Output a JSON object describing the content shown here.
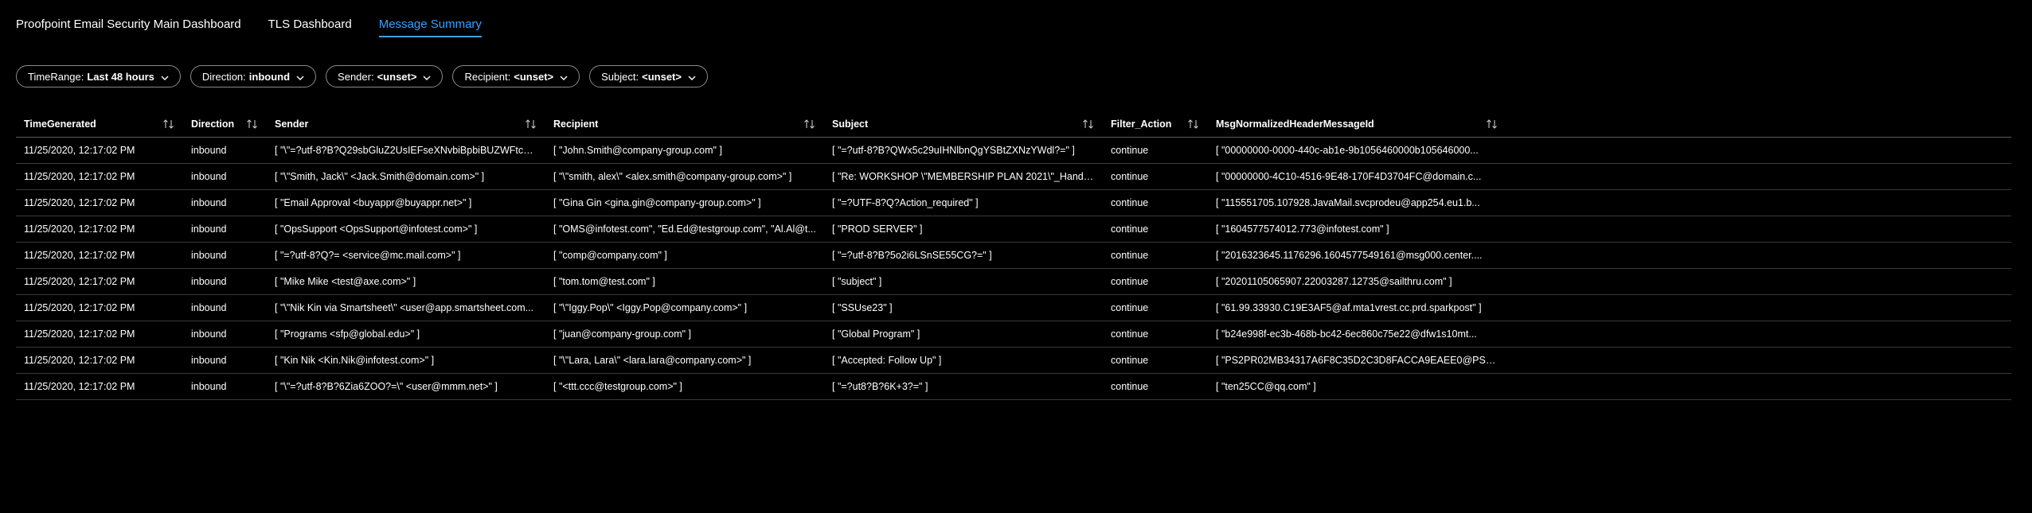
{
  "tabs": [
    {
      "label": "Proofpoint Email Security Main Dashboard",
      "active": false
    },
    {
      "label": "TLS Dashboard",
      "active": false
    },
    {
      "label": "Message Summary",
      "active": true
    }
  ],
  "filters": [
    {
      "name": "TimeRange:",
      "value": "Last 48 hours"
    },
    {
      "name": "Direction:",
      "value": "inbound"
    },
    {
      "name": "Sender:",
      "value": "<unset>"
    },
    {
      "name": "Recipient:",
      "value": "<unset>"
    },
    {
      "name": "Subject:",
      "value": "<unset>"
    }
  ],
  "table": {
    "columns": [
      "TimeGenerated",
      "Direction",
      "Sender",
      "Recipient",
      "Subject",
      "Filter_Action",
      "MsgNormalizedHeaderMessageId"
    ],
    "rows": [
      [
        "11/25/2020, 12:17:02 PM",
        "inbound",
        "[ \"\\\"=?utf-8?B?Q29sbGluZ2UsIEFseXNvbiBpbiBUZWFtcw==...",
        "[ \"John.Smith@company-group.com\" ]",
        "[ \"=?utf-8?B?QWx5c29uIHNlbnQgYSBtZXNzYWdl?=\" ]",
        "continue",
        "[ \"00000000-0000-440c-ab1e-9b1056460000b105646000..."
      ],
      [
        "11/25/2020, 12:17:02 PM",
        "inbound",
        "[ \"\\\"Smith, Jack\\\" <Jack.Smith@domain.com>\" ]",
        "[ \"\\\"smith, alex\\\" <alex.smith@company-group.com>\" ]",
        "[ \"Re: WORKSHOP \\\"MEMBERSHIP PLAN 2021\\\"_Handove...",
        "continue",
        "[ \"00000000-4C10-4516-9E48-170F4D3704FC@domain.c..."
      ],
      [
        "11/25/2020, 12:17:02 PM",
        "inbound",
        "[ \"Email Approval <buyappr@buyappr.net>\" ]",
        "[ \"Gina Gin <gina.gin@company-group.com>\" ]",
        "[ \"=?UTF-8?Q?Action_required\" ]",
        "continue",
        "[ \"115551705.107928.JavaMail.svcprodeu@app254.eu1.b..."
      ],
      [
        "11/25/2020, 12:17:02 PM",
        "inbound",
        "[ \"OpsSupport <OpsSupport@infotest.com>\" ]",
        "[ \"OMS@infotest.com\", \"Ed.Ed@testgroup.com\", \"Al.Al@t...",
        "[ \"PROD SERVER\" ]",
        "continue",
        "[ \"1604577574012.773@infotest.com\" ]"
      ],
      [
        "11/25/2020, 12:17:02 PM",
        "inbound",
        "[ \"=?utf-8?Q?= <service@mc.mail.com>\" ]",
        "[ \"comp@company.com\" ]",
        "[ \"=?utf-8?B?5o2i6LSnSE55CG?=\" ]",
        "continue",
        "[ \"2016323645.1176296.1604577549161@msg000.center...."
      ],
      [
        "11/25/2020, 12:17:02 PM",
        "inbound",
        "[ \"Mike Mike <test@axe.com>\" ]",
        "[ \"tom.tom@test.com\" ]",
        "[ \"subject\" ]",
        "continue",
        "[ \"20201105065907.22003287.12735@sailthru.com\" ]"
      ],
      [
        "11/25/2020, 12:17:02 PM",
        "inbound",
        "[ \"\\\"Nik Kin via Smartsheet\\\" <user@app.smartsheet.com...",
        "[ \"\\\"Iggy.Pop\\\" <Iggy.Pop@company.com>\" ]",
        "[ \"SSUse23\" ]",
        "continue",
        "[ \"61.99.33930.C19E3AF5@af.mta1vrest.cc.prd.sparkpost\" ]"
      ],
      [
        "11/25/2020, 12:17:02 PM",
        "inbound",
        "[ \"Programs <sfp@global.edu>\" ]",
        "[ \"juan@company-group.com\" ]",
        "[ \"Global Program\" ]",
        "continue",
        "[ \"b24e998f-ec3b-468b-bc42-6ec860c75e22@dfw1s10mt..."
      ],
      [
        "11/25/2020, 12:17:02 PM",
        "inbound",
        "[ \"Kin Nik <Kin.Nik@infotest.com>\" ]",
        "[ \"\\\"Lara, Lara\\\" <lara.lara@company.com>\" ]",
        "[ \"Accepted: Follow Up\" ]",
        "continue",
        "[ \"PS2PR02MB34317A6F8C35D2C3D8FACCA9EAEE0@PS2..."
      ],
      [
        "11/25/2020, 12:17:02 PM",
        "inbound",
        "[ \"\\\"=?utf-8?B?6Zia6ZOO?=\\\" <user@mmm.net>\" ]",
        "[ \"<ttt.ccc@testgroup.com>\" ]",
        "[ \"=?ut8?B?6K+3?=\" ]",
        "continue",
        "[ \"ten25CC@qq.com\" ]"
      ]
    ]
  },
  "icons": {
    "chevron": "chevron-down-icon",
    "sort": "sort-icon"
  },
  "colors": {
    "background": "#000000",
    "accent": "#3aa0ff",
    "text": "#ffffff",
    "border": "#3a3a3a"
  }
}
